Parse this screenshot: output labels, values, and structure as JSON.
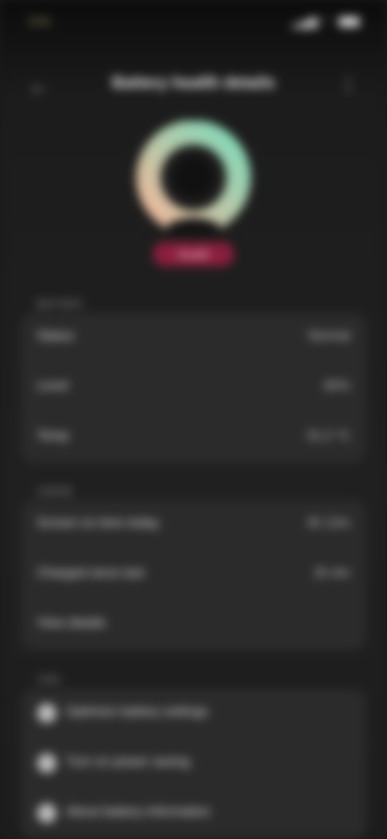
{
  "status_bar": {
    "time": "9:41",
    "signal_text": "▂▄▆ ◠"
  },
  "header": {
    "back_icon": "arrow-left-icon",
    "title": "Battery health details",
    "menu_icon": "more-vertical-icon"
  },
  "gauge": {
    "colors": {
      "top": "#7fd9b8",
      "bottom": "#f0b89a"
    },
    "badge_label": "Health"
  },
  "section_1": {
    "label": "BATTERY",
    "rows": [
      {
        "key": "Status",
        "value": "Normal"
      },
      {
        "key": "Level",
        "value": "82%"
      },
      {
        "key": "Temp",
        "value": "31.2 °C"
      }
    ]
  },
  "section_2": {
    "label": "USAGE",
    "rows": [
      {
        "key": "Screen on time today",
        "value": "3h 12m"
      },
      {
        "key": "Charged since last",
        "value": "2h 4m"
      },
      {
        "key": "View details",
        "value": ""
      }
    ]
  },
  "section_3": {
    "label": "TIPS",
    "rows": [
      {
        "icon": "bulb-icon",
        "key": "Optimize battery settings"
      },
      {
        "icon": "bulb-icon",
        "key": "Turn on power saving"
      },
      {
        "icon": "info-icon",
        "key": "About battery information"
      }
    ]
  }
}
